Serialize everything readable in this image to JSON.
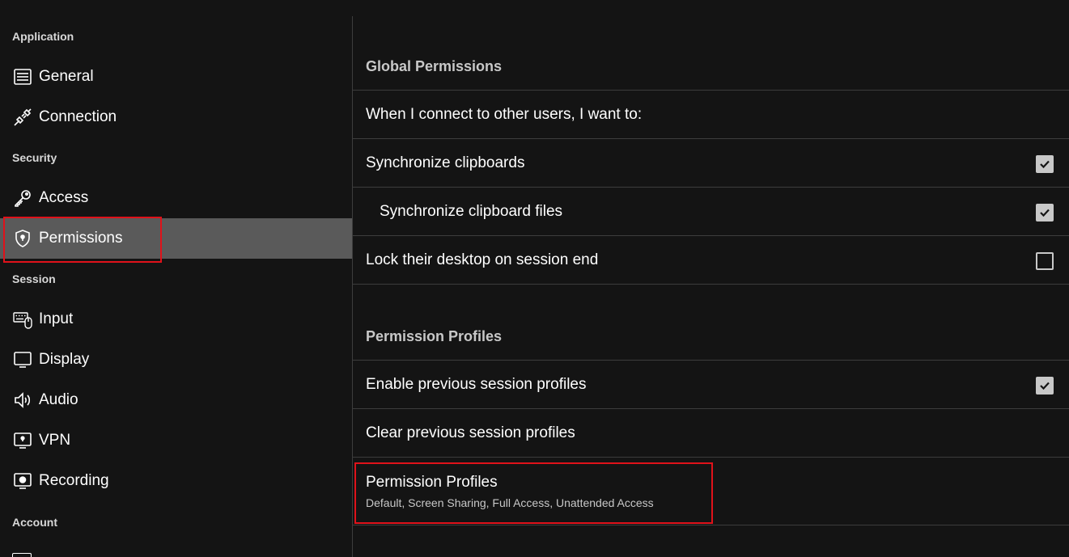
{
  "sidebar": {
    "sections": {
      "application": "Application",
      "security": "Security",
      "session": "Session",
      "account": "Account"
    },
    "items": [
      {
        "label": "General",
        "icon": "general-icon"
      },
      {
        "label": "Connection",
        "icon": "plug-icon"
      },
      {
        "label": "Access",
        "icon": "key-icon"
      },
      {
        "label": "Permissions",
        "icon": "shield-icon",
        "active": true
      },
      {
        "label": "Input",
        "icon": "keyboard-mouse-icon"
      },
      {
        "label": "Display",
        "icon": "monitor-icon"
      },
      {
        "label": "Audio",
        "icon": "speaker-icon"
      },
      {
        "label": "VPN",
        "icon": "vpn-icon"
      },
      {
        "label": "Recording",
        "icon": "recording-icon"
      }
    ]
  },
  "main": {
    "global_permissions": {
      "header": "Global Permissions",
      "intro": "When I connect to other users, I want to:",
      "options": [
        {
          "label": "Synchronize clipboards",
          "checked": true
        },
        {
          "label": "Synchronize clipboard files",
          "checked": true
        },
        {
          "label": "Lock their desktop on session end",
          "checked": false
        }
      ]
    },
    "permission_profiles": {
      "header": "Permission Profiles",
      "enable_previous": {
        "label": "Enable previous session profiles",
        "checked": true
      },
      "clear_previous": {
        "label": "Clear previous session profiles"
      },
      "profiles": {
        "label": "Permission Profiles",
        "sub": "Default, Screen Sharing, Full Access, Unattended Access"
      }
    }
  },
  "colors": {
    "background": "#141414",
    "active_item": "#5a5a5a",
    "divider": "#3d3d3d",
    "highlight": "#e0121a"
  }
}
